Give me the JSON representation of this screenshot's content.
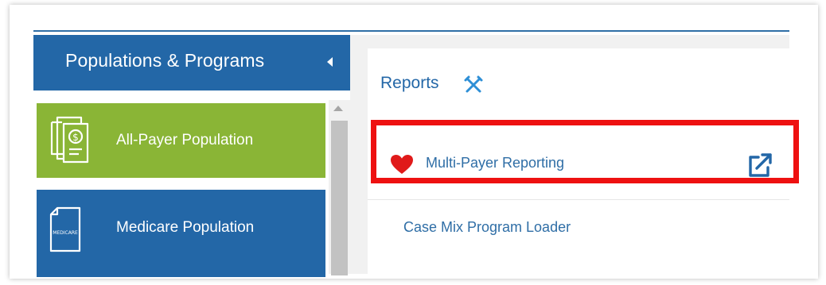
{
  "colors": {
    "primary_blue": "#2367a7",
    "green": "#8ab536",
    "highlight_red": "#ee1111",
    "heart_red": "#e01a1a",
    "panel_gray": "#f1f1f1"
  },
  "sidebar": {
    "title": "Populations & Programs",
    "collapse_icon": "caret-left-icon",
    "items": [
      {
        "label": "All-Payer Population",
        "icon": "documents-dollar-icon",
        "color": "#8ab536"
      },
      {
        "label": "Medicare Population",
        "icon": "medicare-card-icon",
        "icon_text": "MEDICARE",
        "color": "#2367a7"
      }
    ]
  },
  "reports": {
    "title": "Reports",
    "tools_icon": "tools-icon",
    "items": [
      {
        "label": "Multi-Payer Reporting",
        "favorite": true,
        "icon": "heart-icon",
        "action_icon": "external-link-icon",
        "highlighted": true
      },
      {
        "label": "Case Mix Program Loader",
        "favorite": false
      }
    ]
  }
}
